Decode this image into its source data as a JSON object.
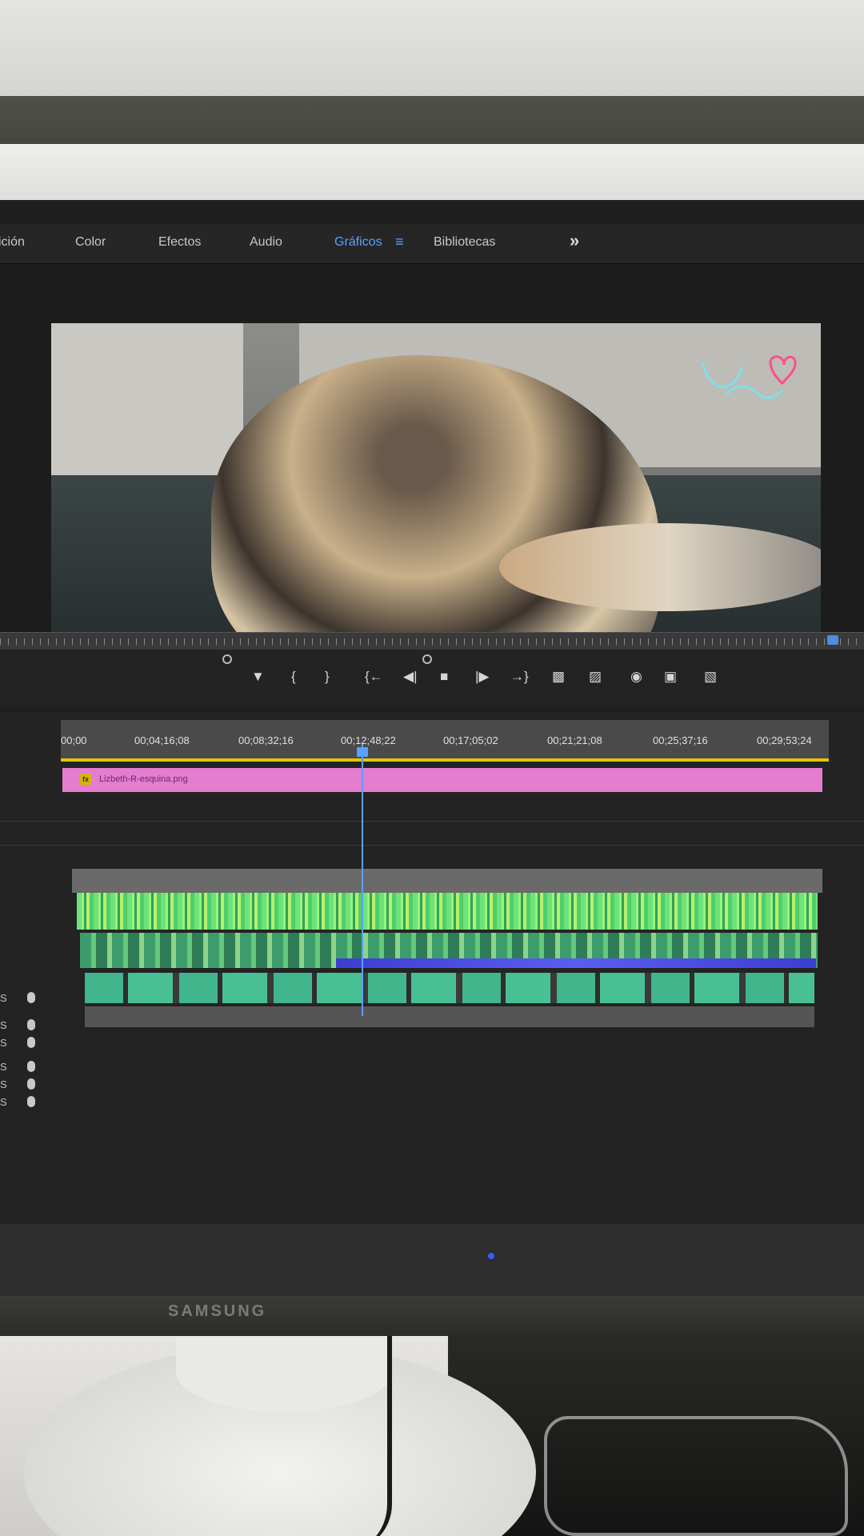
{
  "device": {
    "brand": "SAMSUNG"
  },
  "workspace_tabs": [
    {
      "label": "ición",
      "active": false
    },
    {
      "label": "Color",
      "active": false
    },
    {
      "label": "Efectos",
      "active": false
    },
    {
      "label": "Audio",
      "active": false
    },
    {
      "label": "Gráficos",
      "active": true
    },
    {
      "label": "Bibliotecas",
      "active": false
    }
  ],
  "icons": {
    "workspace_menu": "hamburger-icon",
    "overflow": "double-chevron-right-icon",
    "transport": [
      "add-marker-icon",
      "mark-in-icon",
      "mark-out-icon",
      "go-to-in-icon",
      "step-back-icon",
      "stop-icon",
      "step-forward-icon",
      "go-to-out-icon",
      "lift-icon",
      "extract-icon",
      "export-frame-icon",
      "compare-view-icon",
      "multi-view-icon"
    ]
  },
  "timeline": {
    "timecodes": [
      "00;00",
      "00;04;16;08",
      "00;08;32;16",
      "00;12;48;22",
      "00;17;05;02",
      "00;21;21;08",
      "00;25;37;16",
      "00;29;53;24"
    ],
    "graphic_clip": {
      "fx_badge": "fx",
      "label": "Lizbeth-R-esquina.png"
    },
    "audio_tracks": [
      "S",
      "S",
      "S",
      "S",
      "S",
      "S"
    ]
  },
  "colors": {
    "active_tab": "#58a3ff",
    "graphic_clip": "#e47cd0",
    "video_clips": "#6ee37a",
    "audio_clips": "#41b58b",
    "playhead": "#5aa0ff",
    "work_area": "#e4c400"
  }
}
